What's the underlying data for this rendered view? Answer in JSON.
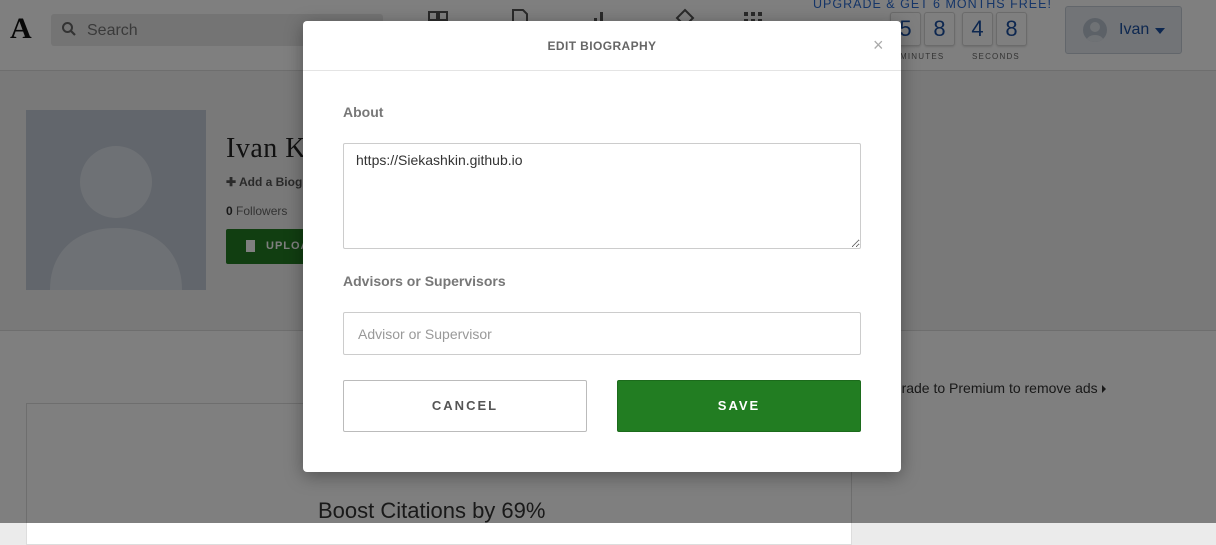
{
  "header": {
    "logo": "A",
    "search_placeholder": "Search",
    "promo_text": "UPGRADE & GET 6 MONTHS FREE!",
    "countdown": {
      "digits": [
        "5",
        "8",
        "4",
        "8"
      ],
      "minutes_label": "MINUTES",
      "seconds_label": "SECONDS"
    },
    "user_name": "Ivan",
    "nav_icons": [
      "papers-icon",
      "document-icon",
      "analytics-icon",
      "mentions-icon",
      "apps-grid-icon"
    ]
  },
  "profile": {
    "name": "Ivan K",
    "add_bio_label": "Add a Biogr",
    "followers_count": "0",
    "followers_label": "Followers",
    "upload_label": "UPLOA"
  },
  "lower": {
    "premium_link": "pgrade to Premium to remove ads",
    "boost_text": "Boost Citations by 69%"
  },
  "modal": {
    "title": "EDIT BIOGRAPHY",
    "close_symbol": "×",
    "about_label": "About",
    "about_value": "https://Siekashkin.github.io",
    "advisors_label": "Advisors or Supervisors",
    "advisor_placeholder": "Advisor or Supervisor",
    "advisor_value": "",
    "cancel_label": "CANCEL",
    "save_label": "SAVE"
  },
  "colors": {
    "accent_blue": "#1a4fa0",
    "promo_blue": "#2a6bd1",
    "save_green": "#227d22"
  }
}
